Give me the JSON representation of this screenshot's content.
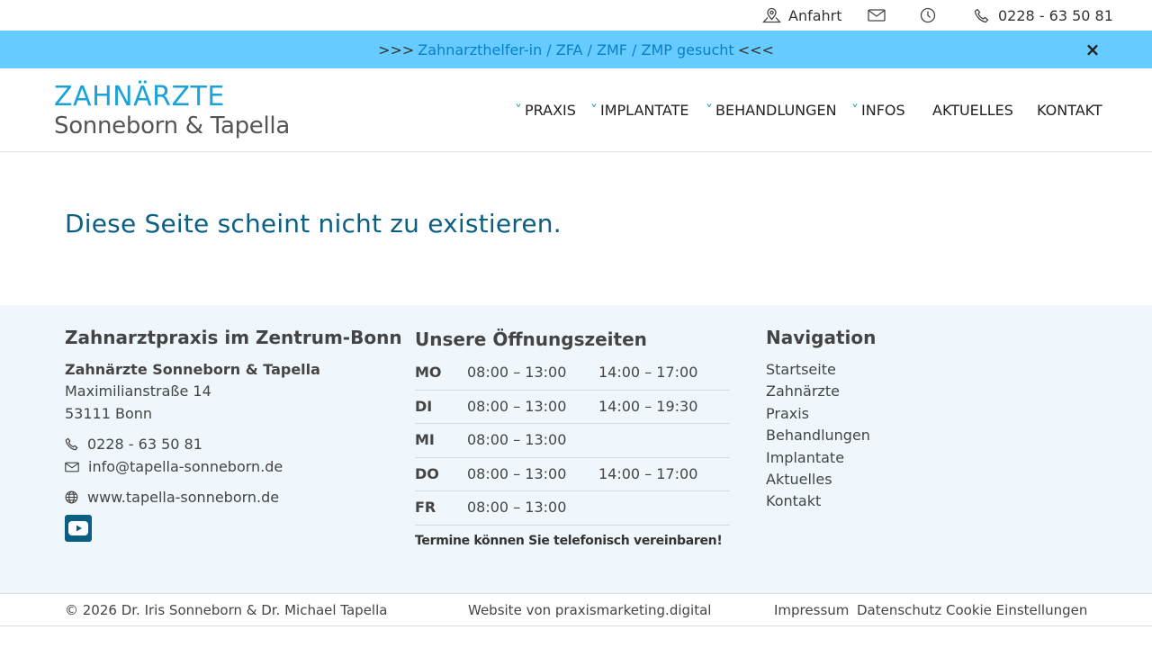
{
  "topbar": {
    "directions_label": "Anfahrt",
    "phone": "0228 - 63 50 81"
  },
  "announcement": {
    "prefix": ">>>",
    "link_text": "Zahnarzthelfer-in / ZFA / ZMF / ZMP gesucht",
    "suffix": "<<<",
    "close_glyph": "×"
  },
  "header": {
    "logo_line1": "ZAHNÄRZTE",
    "logo_line2": "Sonneborn & Tapella",
    "nav": [
      {
        "label": "PRAXIS"
      },
      {
        "label": "IMPLANTATE"
      },
      {
        "label": "BEHANDLUNGEN"
      },
      {
        "label": "INFOS"
      },
      {
        "label": "AKTUELLES"
      },
      {
        "label": "KONTAKT"
      }
    ],
    "chevron": "˅"
  },
  "main": {
    "title": "Diese Seite scheint nicht zu existieren."
  },
  "footer": {
    "col1": {
      "heading": "Zahnarztpraxis im Zentrum-Bonn",
      "name": "Zahnärzte Sonneborn & Tapella",
      "street": "Maximilianstraße 14",
      "city": "53111 Bonn",
      "phone": "0228 - 63 50 81",
      "email": "info@tapella-sonneborn.de",
      "website": "www.tapella-sonneborn.de"
    },
    "col2": {
      "heading": "Unsere Öffnungszeiten",
      "rows": [
        {
          "day": "MO",
          "t1": "08:00 – 13:00",
          "t2": "14:00 – 17:00"
        },
        {
          "day": "DI",
          "t1": "08:00 – 13:00",
          "t2": "14:00 – 19:30"
        },
        {
          "day": "MI",
          "t1": "08:00 – 13:00",
          "t2": ""
        },
        {
          "day": "DO",
          "t1": "08:00 – 13:00",
          "t2": "14:00 – 17:00"
        },
        {
          "day": "FR",
          "t1": "08:00 – 13:00",
          "t2": ""
        }
      ],
      "note": "Termine können Sie telefonisch vereinbaren!"
    },
    "col3": {
      "heading": "Navigation",
      "links": [
        "Startseite",
        "Zahnärzte",
        "Praxis",
        "Behandlungen",
        "Implantate",
        "Aktuelles",
        "Kontakt"
      ]
    }
  },
  "bottombar": {
    "copyright": "© 2026 Dr. Iris Sonneborn & Dr. Michael Tapella",
    "credit": "Website von praxismarketing.digital",
    "impressum": "Impressum",
    "datenschutz": "Datenschutz",
    "cookie": "Cookie Einstellungen"
  },
  "colors": {
    "accent": "#1aa3d9",
    "announce_bg": "#66ccff",
    "title": "#0b5f82",
    "footer_bg": "#f0f7fc"
  }
}
